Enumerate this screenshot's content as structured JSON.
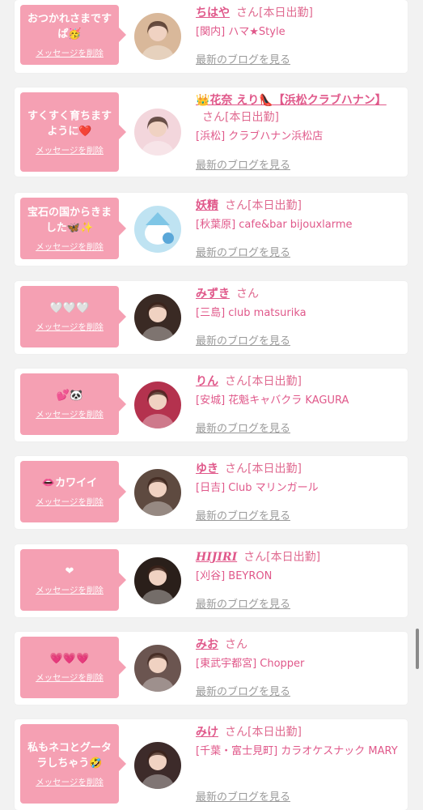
{
  "messages": [
    {
      "message": "おつかれさまですぱ🥳",
      "delete_label": "メッセージを削除",
      "name": "ちはや",
      "suffix": "さん",
      "status": "[本日出勤]",
      "shop": "[関内] ハマ★Style",
      "blog_label": "最新のブログを見る",
      "avatar_icon": "cast-photo-icon",
      "avatar_color": "#d9b89a"
    },
    {
      "message": "すくすく育ちますように❤️",
      "delete_label": "メッセージを削除",
      "name": "👑花奈 えり👠【浜松クラブハナン】",
      "suffix": "さん",
      "status": "[本日出勤]",
      "shop": "[浜松] クラブハナン浜松店",
      "blog_label": "最新のブログを見る",
      "avatar_icon": "cast-photo-icon",
      "avatar_color": "#f3d6dc"
    },
    {
      "message": "宝石の国からきました🦋✨",
      "delete_label": "メッセージを削除",
      "name": "妖精",
      "suffix": "さん",
      "status": "[本日出勤]",
      "shop": "[秋葉原] cafe&bar bijouxlarme",
      "blog_label": "最新のブログを見る",
      "avatar_icon": "fairy-character-icon",
      "avatar_color": "#bfe3f2"
    },
    {
      "message": "🤍🤍🤍",
      "delete_label": "メッセージを削除",
      "name": "みずき",
      "suffix": "さん",
      "status": "",
      "shop": "[三島] club matsurika",
      "blog_label": "最新のブログを見る",
      "avatar_icon": "cast-photo-icon",
      "avatar_color": "#3a2a24"
    },
    {
      "message": "💕🐼",
      "delete_label": "メッセージを削除",
      "name": "りん",
      "suffix": "さん",
      "status": "[本日出勤]",
      "shop": "[安城] 花魁キャバクラ KAGURA",
      "blog_label": "最新のブログを見る",
      "avatar_icon": "cast-photo-icon",
      "avatar_color": "#b4324e"
    },
    {
      "message": "👄カワイイ",
      "delete_label": "メッセージを削除",
      "name": "ゆき",
      "suffix": "さん",
      "status": "[本日出勤]",
      "shop": "[日吉] Club マリンガール",
      "blog_label": "最新のブログを見る",
      "avatar_icon": "cast-photo-icon",
      "avatar_color": "#5e4a40"
    },
    {
      "message": "❤",
      "delete_label": "メッセージを削除",
      "name": "HIJIRI",
      "suffix": "さん",
      "status": "[本日出勤]",
      "shop": "[刈谷] BEYRON",
      "blog_label": "最新のブログを見る",
      "avatar_icon": "cast-photo-icon",
      "avatar_color": "#2a1f1a"
    },
    {
      "message": "💗💗💗",
      "delete_label": "メッセージを削除",
      "name": "みお",
      "suffix": "さん",
      "status": "",
      "shop": "[東武宇都宮] Chopper",
      "blog_label": "最新のブログを見る",
      "avatar_icon": "cast-photo-icon",
      "avatar_color": "#6b5550"
    },
    {
      "message": "私もネコとグータラしちゃう🤣",
      "delete_label": "メッセージを削除",
      "name": "みけ",
      "suffix": "さん",
      "status": "[本日出勤]",
      "shop": "[千葉・富士見町] カラオケスナック MARY",
      "blog_label": "最新のブログを見る",
      "avatar_icon": "cast-photo-icon",
      "avatar_color": "#3d2b2a"
    }
  ]
}
